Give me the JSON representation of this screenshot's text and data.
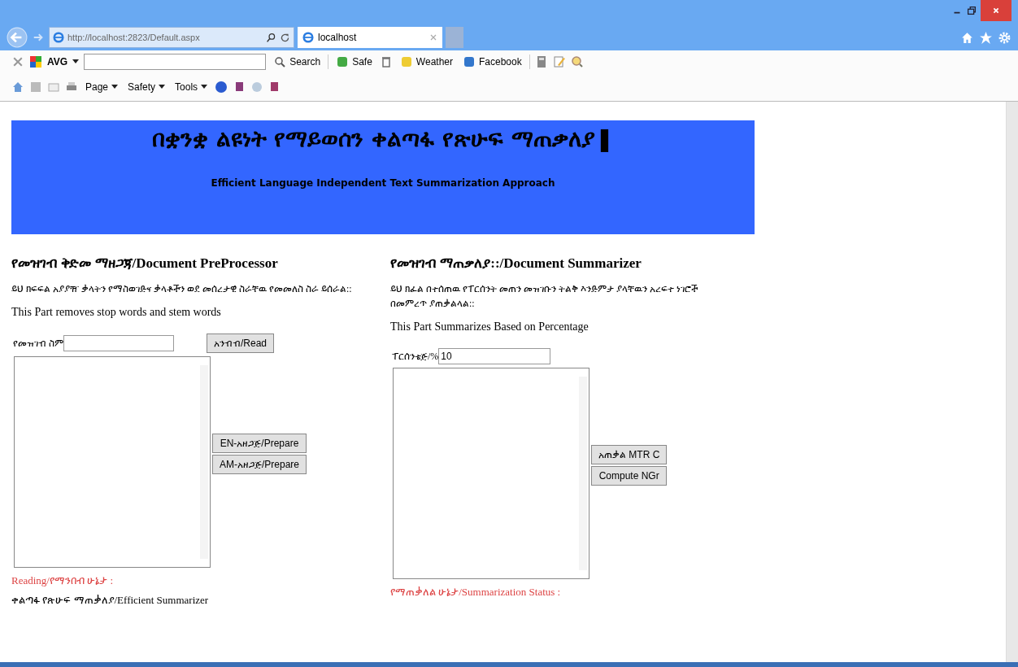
{
  "browser": {
    "address": "http://localhost:2823/Default.aspx",
    "tab_title": "localhost",
    "avg": "AVG",
    "search_button": "Search",
    "toolbar_items": [
      "Safe",
      "Weather",
      "Facebook"
    ],
    "command_items": [
      "Page",
      "Safety",
      "Tools"
    ]
  },
  "banner": {
    "title": "በቋንቋ ልዩነት የማይወሰን ቀልጣፋ የጽሁፍ ማጠቃለያ❚",
    "subtitle": "Efficient Language Independent Text Summarization Approach"
  },
  "preprocessor": {
    "heading": "የመዝገብ ቅድመ ማዘጋጃ/Document PreProcessor",
    "description_am": "ይህ ክፍፍል አያያዥ ቃላትን የማስወገድና ቃላቶችን ወደ መሰረታዊ ስራቸዉ የመመለስ ስራ ይሰራል::",
    "description_en": "This Part removes stop words and stem words",
    "name_label": "የመዝገብ ስም",
    "read_button": "አንብብ/Read",
    "buttons": [
      "EN-አዘጋጅ/Prepare",
      "AM-አዘጋጅ/Prepare"
    ],
    "status_label": "Reading/የማንበብ ሁኔታ :",
    "footer": "ቀልጣፋ የጽሁፍ ማጠቃለያ/Efficient Summarizer"
  },
  "summarizer": {
    "heading": "የመዝገብ ማጠቃለያ::/Document Summarizer",
    "description_am": "ይህ ክፈል በተሰጠዉ የፐርሰንት መጠን መዝገቡን ትልቅ እንድምታ ያላቸዉን አረፍተ ነገሮች በመምረጥ ያጠቃልላል::",
    "description_en": "This Part Summarizes Based on Percentage",
    "percent_label": "ፐርሰንቴጅ/%",
    "percent_value": "10",
    "buttons": [
      "አጠቃል MTR C",
      "Compute NGr"
    ],
    "status_label": "የማጠቃለል ሁኔታ/Summarization Status :"
  }
}
